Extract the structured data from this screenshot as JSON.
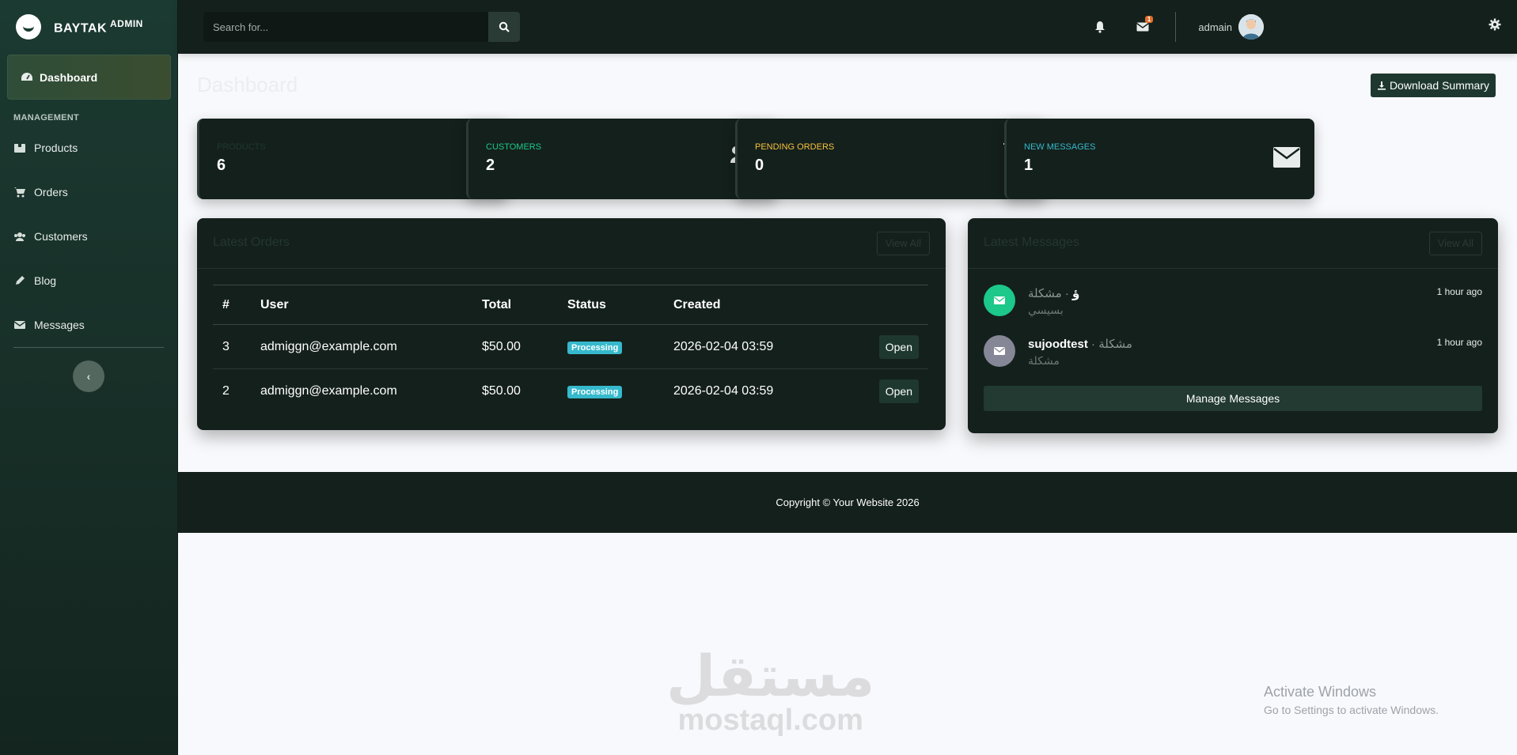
{
  "brand": {
    "name": "BAYTAK",
    "suffix": "ADMIN"
  },
  "sidebar": {
    "active_item": {
      "label": "Dashboard",
      "icon": "tachometer-icon"
    },
    "heading": "MANAGEMENT",
    "items": [
      {
        "label": "Products",
        "icon": "box-icon"
      },
      {
        "label": "Orders",
        "icon": "cart-icon"
      },
      {
        "label": "Customers",
        "icon": "users-icon"
      },
      {
        "label": "Blog",
        "icon": "pen-icon"
      },
      {
        "label": "Messages",
        "icon": "envelope-icon"
      }
    ],
    "toggle_icon": "chevron-left-icon"
  },
  "topbar": {
    "search_placeholder": "Search for...",
    "message_badge": "1",
    "user_name": "admain"
  },
  "page": {
    "title": "Dashboard",
    "download_label": "Download Summary"
  },
  "stats": [
    {
      "label": "PRODUCTS",
      "value": "6",
      "color": "#1e3830",
      "icon": "box-open-icon"
    },
    {
      "label": "CUSTOMERS",
      "value": "2",
      "color": "#1cc88a",
      "icon": "users-icon"
    },
    {
      "label": "PENDING ORDERS",
      "value": "0",
      "color": "#f6c23e",
      "icon": "cart-icon"
    },
    {
      "label": "NEW MESSAGES",
      "value": "1",
      "color": "#36b9cc",
      "icon": "envelope-icon"
    }
  ],
  "orders": {
    "title": "Latest Orders",
    "view_all": "View All",
    "columns": [
      "#",
      "User",
      "Total",
      "Status",
      "Created"
    ],
    "rows": [
      {
        "id": "3",
        "user": "admiggn@example.com",
        "total": "$50.00",
        "status": "Processing",
        "created": "2026-02-04 03:59",
        "action": "Open"
      },
      {
        "id": "2",
        "user": "admiggn@example.com",
        "total": "$50.00",
        "status": "Processing",
        "created": "2026-02-04 03:59",
        "action": "Open"
      }
    ]
  },
  "messages": {
    "title": "Latest Messages",
    "view_all": "View All",
    "items": [
      {
        "from": "ؤ",
        "subject": "· مشكلة",
        "body": "بسيسي",
        "time": "1 hour ago",
        "avatar_color": "#1cc88a"
      },
      {
        "from": "sujoodtest",
        "subject": "· مشكلة",
        "body": "مشكلة",
        "time": "1 hour ago",
        "avatar_color": "#858796"
      }
    ],
    "manage_label": "Manage Messages"
  },
  "footer": {
    "copyright": "Copyright © Your Website 2026"
  },
  "watermark": {
    "arabic": "مستقل",
    "latin": "mostaql.com"
  },
  "os_notice": {
    "title": "Activate Windows",
    "subtitle": "Go to Settings to activate Windows."
  }
}
